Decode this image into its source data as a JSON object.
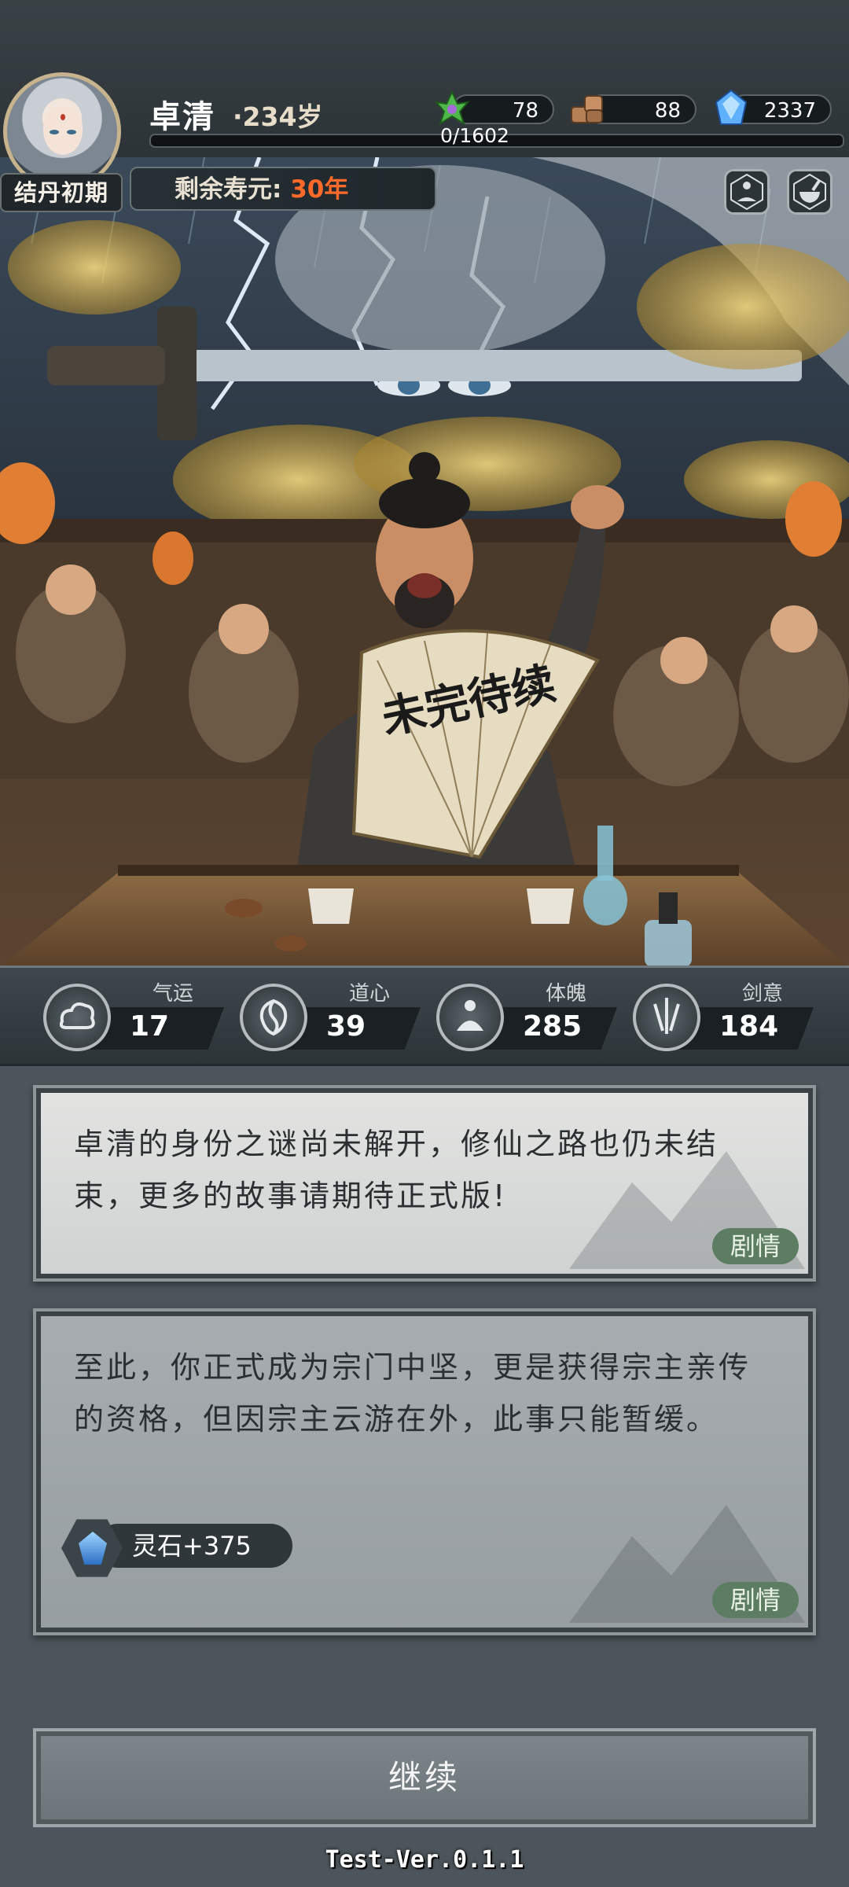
{
  "player": {
    "name": "卓清",
    "age": "·234岁",
    "realm": "结丹初期",
    "lifespan_label": "剩余寿元:",
    "lifespan_value": "30年"
  },
  "resources": [
    {
      "icon": "herb-icon",
      "value": "78"
    },
    {
      "icon": "wood-icon",
      "value": "88"
    },
    {
      "icon": "spirit-stone-icon",
      "value": "2337"
    }
  ],
  "progress": {
    "text": "0/1602",
    "fraction": 0.0
  },
  "illustration": {
    "fan_text": "未完待续"
  },
  "stats": [
    {
      "label": "气运",
      "value": "17",
      "icon": "cloud-icon"
    },
    {
      "label": "道心",
      "value": "39",
      "icon": "yin-yang-icon"
    },
    {
      "label": "体魄",
      "value": "285",
      "icon": "meditation-icon"
    },
    {
      "label": "剑意",
      "value": "184",
      "icon": "swords-icon"
    }
  ],
  "cards": [
    {
      "text": "卓清的身份之谜尚未解开，修仙之路也仍未结束，更多的故事请期待正式版!",
      "tag": "剧情"
    },
    {
      "text": "至此，你正式成为宗门中坚，更是获得宗主亲传的资格，但因宗主云游在外，此事只能暂缓。",
      "tag": "剧情",
      "reward": "灵石+375"
    }
  ],
  "continue_label": "继续",
  "version": "Test-Ver.0.1.1"
}
